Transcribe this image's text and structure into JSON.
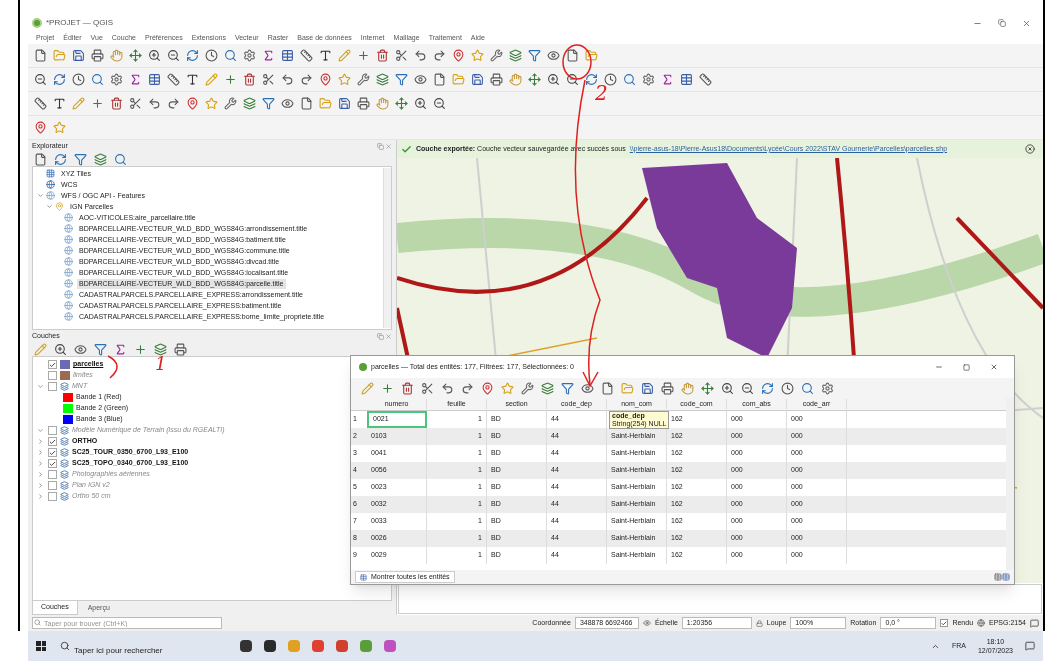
{
  "window": {
    "title": "*PROJET — QGIS"
  },
  "menu": [
    "Projet",
    "Éditer",
    "Vue",
    "Couche",
    "Préférences",
    "Extensions",
    "Vecteur",
    "Raster",
    "Base de données",
    "Internet",
    "Maillage",
    "Traitement",
    "Aide"
  ],
  "explorer": {
    "title": "Explorateur",
    "items": [
      {
        "label": "XYZ Tiles",
        "kind": "tiles",
        "selected": false
      },
      {
        "label": "WCS",
        "kind": "globe",
        "selected": false
      },
      {
        "label": "WFS / OGC API - Features",
        "kind": "service",
        "expanded": true,
        "selected": false,
        "children": [
          {
            "label": "IGN Parcelles",
            "kind": "connection",
            "expanded": true,
            "selected": false,
            "children": [
              {
                "label": "AOC-VITICOLES:aire_parcellaire.title",
                "kind": "service",
                "selected": false
              },
              {
                "label": "BDPARCELLAIRE-VECTEUR_WLD_BDD_WGS84G:arrondissement.title",
                "kind": "service",
                "selected": false
              },
              {
                "label": "BDPARCELLAIRE-VECTEUR_WLD_BDD_WGS84G:batiment.title",
                "kind": "service",
                "selected": false
              },
              {
                "label": "BDPARCELLAIRE-VECTEUR_WLD_BDD_WGS84G:commune.title",
                "kind": "service",
                "selected": false
              },
              {
                "label": "BDPARCELLAIRE-VECTEUR_WLD_BDD_WGS84G:divcad.title",
                "kind": "service",
                "selected": false
              },
              {
                "label": "BDPARCELLAIRE-VECTEUR_WLD_BDD_WGS84G:localisant.title",
                "kind": "service",
                "selected": false
              },
              {
                "label": "BDPARCELLAIRE-VECTEUR_WLD_BDD_WGS84G:parcelle.title",
                "kind": "service",
                "selected": true
              },
              {
                "label": "CADASTRALPARCELS.PARCELLAIRE_EXPRESS:arrondissement.title",
                "kind": "service",
                "selected": false
              },
              {
                "label": "CADASTRALPARCELS.PARCELLAIRE_EXPRESS:batiment.title",
                "kind": "service",
                "selected": false
              },
              {
                "label": "CADASTRALPARCELS.PARCELLAIRE_EXPRESS:borne_limite_propriete.title",
                "kind": "service",
                "selected": false
              }
            ]
          }
        ]
      }
    ]
  },
  "layers": {
    "title": "Couches",
    "items": [
      {
        "label": "parcelles",
        "kind": "vector",
        "color": "#6b6bb5",
        "checked": true,
        "visible": true,
        "selected": true
      },
      {
        "label": "limites",
        "kind": "vector",
        "color": "#9c6a4f",
        "checked": false,
        "visible": false,
        "selected": false
      },
      {
        "label": "MNT",
        "kind": "raster",
        "checked": false,
        "visible": false,
        "selected": false,
        "expanded": true,
        "children": [
          {
            "label": "Bande 1 (Red)",
            "kind": "band",
            "color": "#ff0000"
          },
          {
            "label": "Bande 2 (Green)",
            "kind": "band",
            "color": "#00ff00"
          },
          {
            "label": "Bande 3 (Blue)",
            "kind": "band",
            "color": "#0000ff"
          }
        ]
      },
      {
        "label": "Modèle Numérique de Terrain (issu du RGEALTI)",
        "kind": "raster",
        "checked": false,
        "visible": false,
        "selected": false,
        "expanded": true
      },
      {
        "label": "ORTHO",
        "kind": "raster",
        "checked": true,
        "visible": true,
        "selected": false,
        "expanded": false
      },
      {
        "label": "SC25_TOUR_0350_6700_L93_E100",
        "kind": "raster",
        "checked": true,
        "visible": true,
        "selected": false,
        "expanded": false
      },
      {
        "label": "SC25_TOPO_0340_6700_L93_E100",
        "kind": "raster",
        "checked": true,
        "visible": true,
        "selected": false,
        "expanded": false
      },
      {
        "label": "Photographies aériennes",
        "kind": "raster",
        "checked": false,
        "visible": false,
        "selected": false,
        "expanded": false
      },
      {
        "label": "Plan IGN v2",
        "kind": "raster",
        "checked": false,
        "visible": false,
        "selected": false,
        "expanded": false
      },
      {
        "label": "Ortho 50 cm",
        "kind": "raster",
        "checked": false,
        "visible": false,
        "selected": false,
        "expanded": false
      }
    ]
  },
  "panel_tabs": [
    {
      "label": "Couches",
      "selected": true
    },
    {
      "label": "Aperçu",
      "selected": false
    }
  ],
  "message": {
    "title": "Couche exportée:",
    "text": "Couche vecteur sauvegardée avec succès sous",
    "link": "\\\\pierre-asus-18\\Pierre-Asus18\\Documents\\Lycée\\Cours 2022\\STAV Gournerie\\Parcelles\\parcelles.shp"
  },
  "attribute_table": {
    "title": "parcelles — Total des entités: 177, Filtrées: 177, Sélectionnées: 0",
    "columns": [
      "numero",
      "feuille",
      "section",
      "code_dep",
      "nom_com",
      "code_com",
      "com_abs",
      "code_arr"
    ],
    "rows": [
      {
        "label": "1",
        "focused": true,
        "cells": [
          "0021",
          "1",
          "BD",
          "44",
          null,
          "162",
          "000",
          "000"
        ]
      },
      {
        "label": "2",
        "focused": false,
        "cells": [
          "0103",
          "1",
          "BD",
          "44",
          "Saint-Herblain",
          "162",
          "000",
          "000"
        ]
      },
      {
        "label": "3",
        "focused": false,
        "cells": [
          "0041",
          "1",
          "BD",
          "44",
          "Saint-Herblain",
          "162",
          "000",
          "000"
        ]
      },
      {
        "label": "4",
        "focused": false,
        "cells": [
          "0056",
          "1",
          "BD",
          "44",
          "Saint-Herblain",
          "162",
          "000",
          "000"
        ]
      },
      {
        "label": "5",
        "focused": false,
        "cells": [
          "0023",
          "1",
          "BD",
          "44",
          "Saint-Herblain",
          "162",
          "000",
          "000"
        ]
      },
      {
        "label": "6",
        "focused": false,
        "cells": [
          "0032",
          "1",
          "BD",
          "44",
          "Saint-Herblain",
          "162",
          "000",
          "000"
        ]
      },
      {
        "label": "7",
        "focused": false,
        "cells": [
          "0033",
          "1",
          "BD",
          "44",
          "Saint-Herblain",
          "162",
          "000",
          "000"
        ]
      },
      {
        "label": "8",
        "focused": false,
        "cells": [
          "0026",
          "1",
          "BD",
          "44",
          "Saint-Herblain",
          "162",
          "000",
          "000"
        ]
      },
      {
        "label": "9",
        "focused": false,
        "cells": [
          "0029",
          "1",
          "BD",
          "44",
          "Saint-Herblain",
          "162",
          "000",
          "000"
        ]
      }
    ],
    "tooltip": {
      "title": "code_dep",
      "text": "String(254) NULL"
    },
    "filter_button": "Montrer toutes les entités"
  },
  "locator": {
    "placeholder": "Taper pour trouver (Ctrl+K)"
  },
  "status_bar": {
    "coordinate_label": "Coordonnée",
    "coordinate": "348878 6692466",
    "scale_label": "Échelle",
    "scale": "1:20356",
    "magnifier_label": "Loupe",
    "magnifier": "100%",
    "rotation_label": "Rotation",
    "rotation": "0,0 °",
    "render_label": "Rendu",
    "render": true,
    "crs": "EPSG:2154"
  },
  "taskbar": {
    "search_placeholder": "Taper ici pour rechercher",
    "language": "FRA",
    "time": "18:10",
    "date": "12/07/2023"
  },
  "annotations": [
    {
      "label": "2"
    },
    {
      "label": "1"
    }
  ]
}
